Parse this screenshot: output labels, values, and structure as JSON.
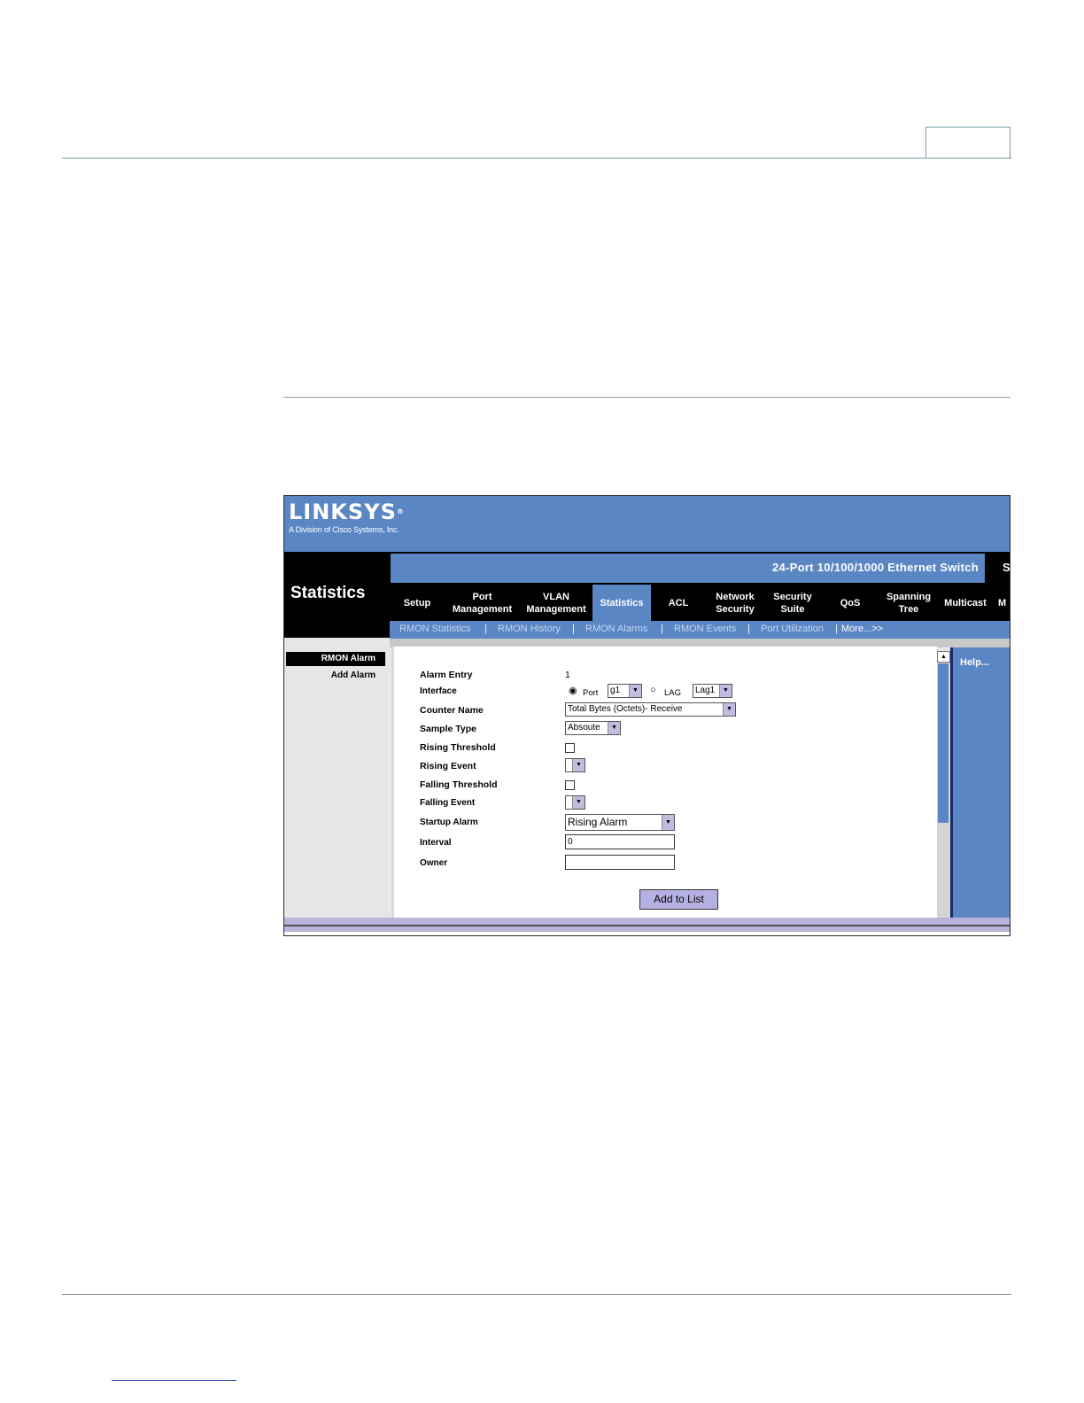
{
  "app": {
    "brand": "LINKSYS",
    "brand_mark": "®",
    "brand_subtitle": "A Division of Cisco Systems, Inc.",
    "product_name": "24-Port 10/100/1000 Ethernet Switch",
    "product_trailing": "S",
    "page_title": "Statistics"
  },
  "tabs": [
    {
      "label": "Setup"
    },
    {
      "label": "Port Management"
    },
    {
      "label": "VLAN Management"
    },
    {
      "label": "Statistics",
      "active": true
    },
    {
      "label": "ACL"
    },
    {
      "label": "Network Security"
    },
    {
      "label": "Security Suite"
    },
    {
      "label": "QoS"
    },
    {
      "label": "Spanning Tree"
    },
    {
      "label": "Multicast"
    },
    {
      "label": "M"
    }
  ],
  "subnav": {
    "items": [
      "RMON Statistics",
      "RMON History",
      "RMON Alarms",
      "RMON Events",
      "Port Utilization",
      "More...>>"
    ],
    "separator": "|"
  },
  "sidebar": {
    "active": "RMON Alarm",
    "item": "Add Alarm"
  },
  "form": {
    "alarm_entry_label": "Alarm Entry",
    "alarm_entry_value": "1",
    "interface_label": "Interface",
    "port_radio_label": "Port",
    "port_value": "g1",
    "lag_radio_label": "LAG",
    "lag_value": "Lag1",
    "counter_name_label": "Counter Name",
    "counter_name_value": "Total Bytes (Octets)- Receive",
    "sample_type_label": "Sample Type",
    "sample_type_value": "Absoute",
    "rising_threshold_label": "Rising Threshold",
    "rising_event_label": "Rising Event",
    "falling_threshold_label": "Falling Threshold",
    "falling_event_label": "Falling Event",
    "startup_alarm_label": "Startup Alarm",
    "startup_alarm_value": "Rising Alarm",
    "interval_label": "Interval",
    "interval_value": "0",
    "owner_label": "Owner",
    "owner_value": "",
    "add_button": "Add to List"
  },
  "help": {
    "label": "Help..."
  },
  "colors": {
    "linksys_blue": "#5b86c4",
    "nav_black": "#000000",
    "button_lavender": "#b5b0e2"
  }
}
